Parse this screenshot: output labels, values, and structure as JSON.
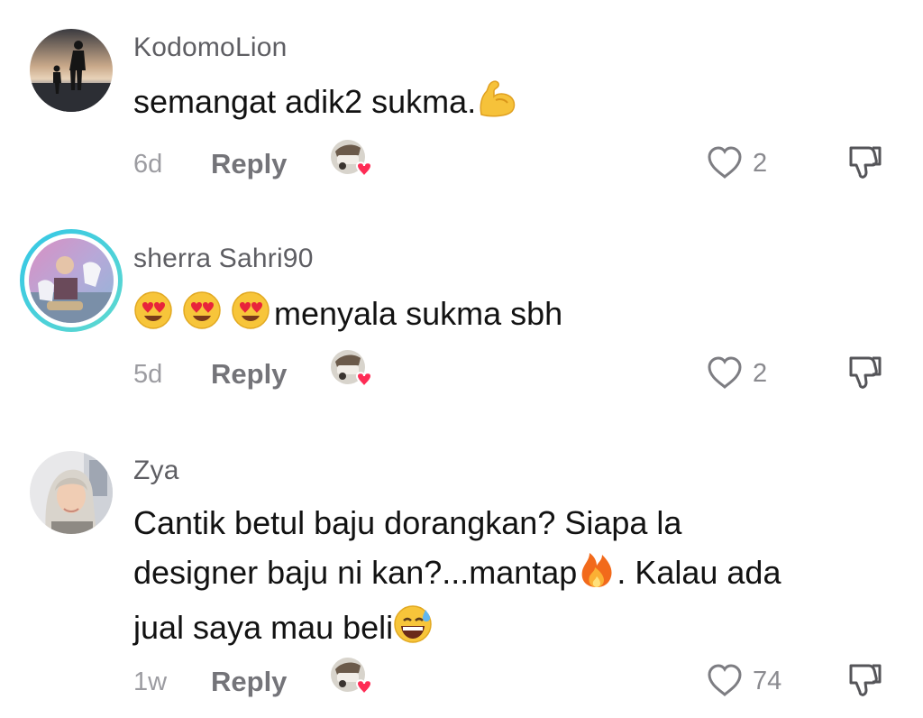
{
  "comments": [
    {
      "username": "KodomoLion",
      "text": "semangat adik2 sukma.",
      "emojis": [
        "flexed-biceps"
      ],
      "age": "6d",
      "reply_label": "Reply",
      "likes": "2"
    },
    {
      "username": "sherra Sahri90",
      "text": "menyala sukma sbh",
      "emojis": [
        "heart-eyes",
        "heart-eyes",
        "heart-eyes"
      ],
      "age": "5d",
      "reply_label": "Reply",
      "likes": "2"
    },
    {
      "username": "Zya",
      "text_line1": "Cantik betul baju dorangkan? Siapa la",
      "text_line2a": "designer baju ni kan?...mantap",
      "text_line2b": ". Kalau ada",
      "text_line3": "jual saya mau beli",
      "emojis": [
        "fire",
        "grinning-sweat"
      ],
      "age": "1w",
      "reply_label": "Reply",
      "likes": "74"
    }
  ],
  "icons": {
    "like": "heart-outline-icon",
    "dislike": "thumbs-down-outline-icon",
    "creator_liked": "creator-liked-heart-badge"
  },
  "colors": {
    "username": "#5e5e63",
    "meta": "#9c9ca1",
    "reply": "#747479",
    "heart_badge": "#fe2c55",
    "story_ring": "#34c7e6"
  }
}
